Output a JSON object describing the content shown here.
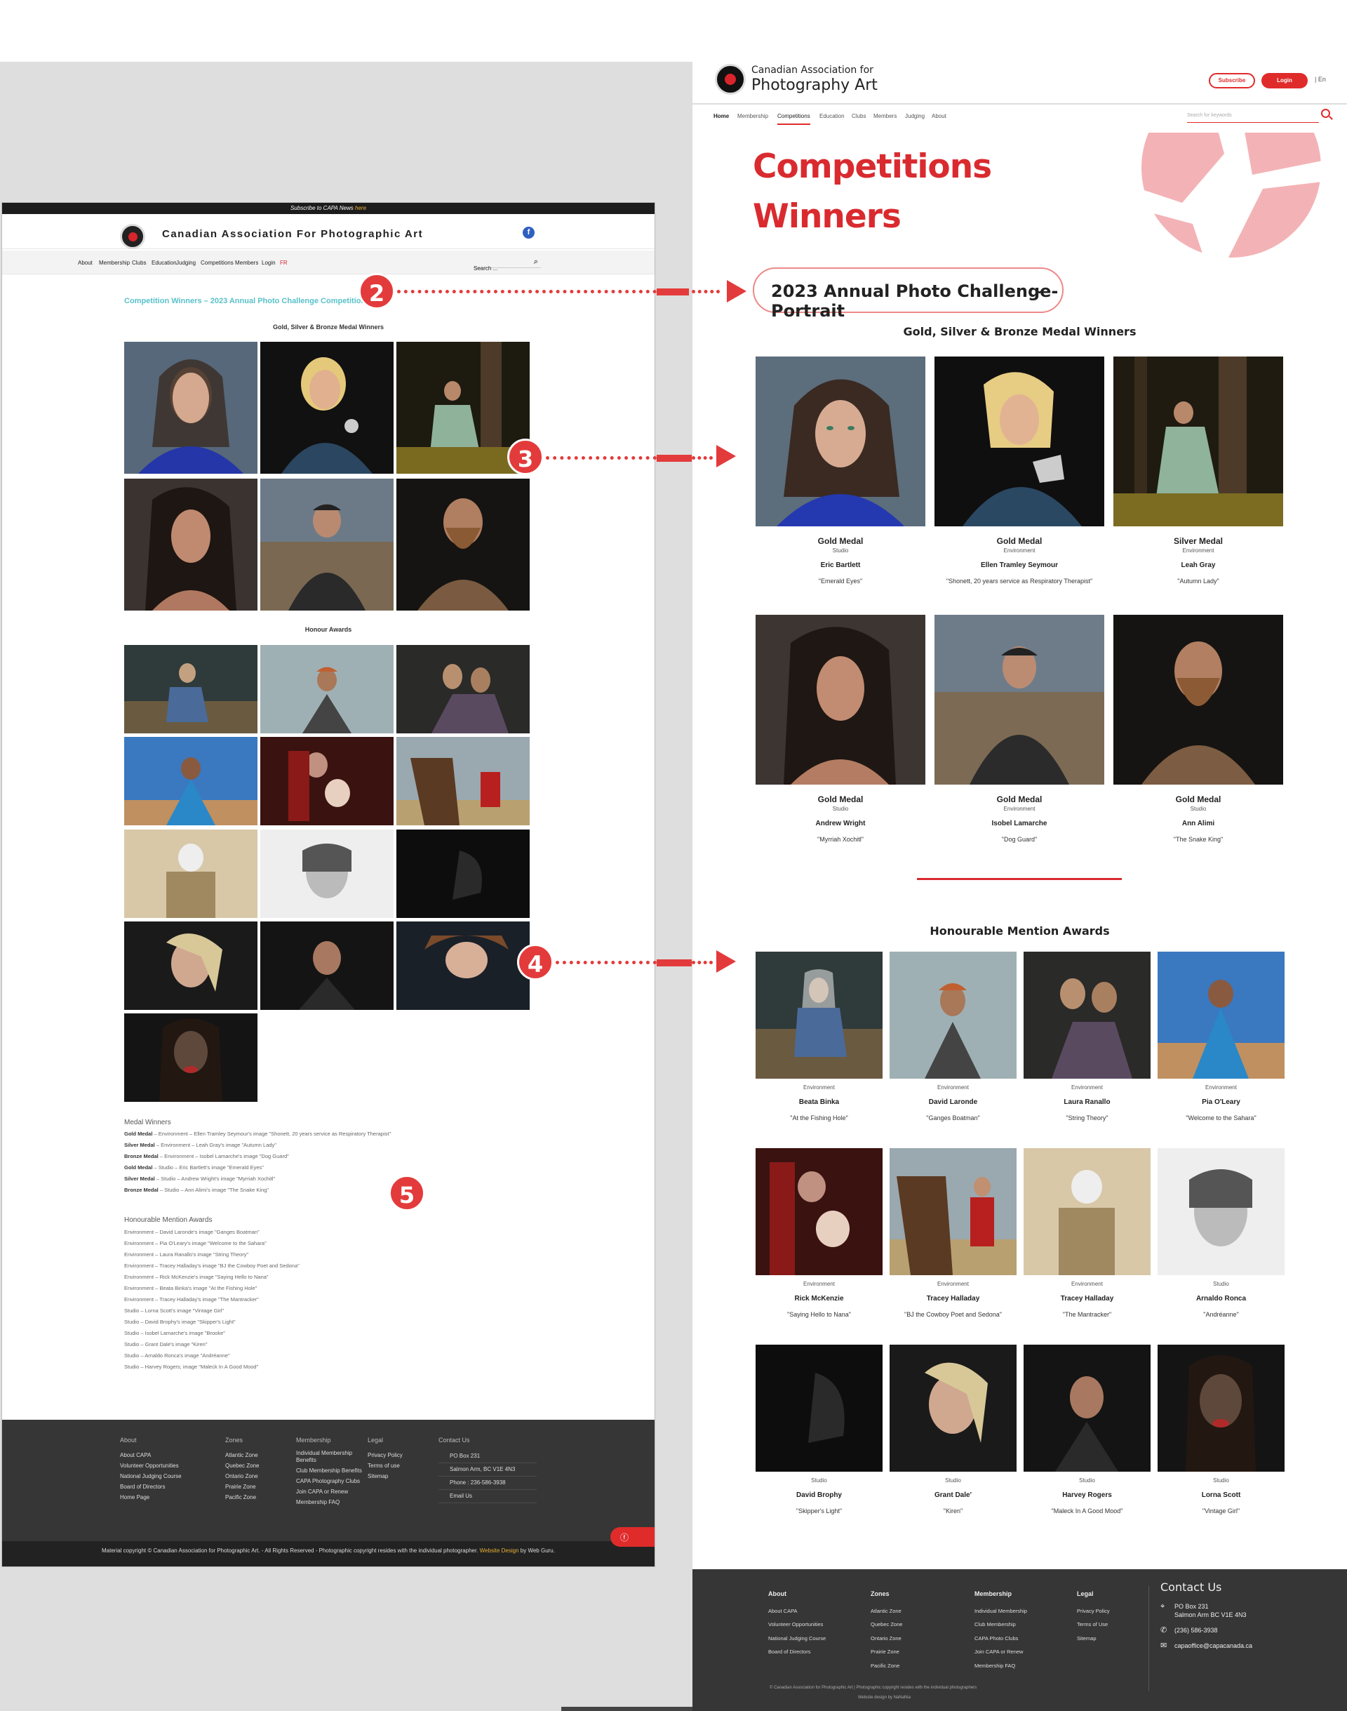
{
  "old_site": {
    "subscribe_text": "Subscribe to CAPA News",
    "subscribe_link": "here",
    "brand": "Canadian Association For Photographic Art",
    "facebook": "f",
    "nav": [
      "About",
      "Membership",
      "Clubs",
      "Education",
      "Judging",
      "Competitions",
      "Members",
      "Login",
      "FR"
    ],
    "search_placeholder": "Search ...",
    "page_title": "Competition Winners – 2023 Annual Photo Challenge Competition",
    "medal_section": "Gold, Silver & Bronze Medal Winners",
    "honour_section": "Honour Awards",
    "medal_list_title": "Medal Winners",
    "medal_list": [
      {
        "medal": "Gold Medal",
        "text": " – Environment – Ellen Tramley Seymour's image \"Shonett, 20 years service as Respiratory Therapist\""
      },
      {
        "medal": "Silver Medal",
        "text": " – Environment – Leah Gray's image \"Autumn Lady\""
      },
      {
        "medal": "Bronze Medal",
        "text": " – Environment – Isobel Lamarche's image \"Dog Guard\""
      },
      {
        "medal": "Gold Medal",
        "text": " – Studio – Eric Bartlett's image \"Emerald Eyes\""
      },
      {
        "medal": "Silver Medal",
        "text": " – Studio – Andrew Wright's image \"Myrriah Xochitl\""
      },
      {
        "medal": "Bronze Medal",
        "text": " – Studio – Ann Alimi's image \"The Snake King\""
      }
    ],
    "honour_list_title": "Honourable Mention Awards",
    "honour_list": [
      "Environment – David Laronde's image \"Ganges Boatman\"",
      "Environment – Pia O'Leary's image \"Welcome to the Sahara\"",
      "Environment – Laura Ranallo's image \"String Theory\"",
      "Environment – Tracey Halladay's image \"BJ the Cowboy Poet and Sedona\"",
      "Environment – Rick McKenzie's image \"Saying Hello to Nana\"",
      "Environment – Beata Binka's image \"At the Fishing Hole\"",
      "Environment – Tracey Halladay's image \"The Mantracker\"",
      "Studio – Lorna Scott's image \"Vintage Girl\"",
      "Studio – David Brophy's image \"Skipper's Light\"",
      "Studio – Isobel Lamarche's image \"Brooke\"",
      "Studio – Grant Dale's image \"Kiren\"",
      "Studio – Arnaldo Ronca's image \"Andréanne\"",
      "Studio – Harvey Rogers; image \"Maleck In A Good Mood\""
    ],
    "footer": {
      "about": {
        "title": "About",
        "items": [
          "About CAPA",
          "Volunteer Opportunities",
          "National Judging Course",
          "Board of Directors",
          "Home Page"
        ]
      },
      "zones": {
        "title": "Zones",
        "items": [
          "Atlantic Zone",
          "Quebec Zone",
          "Ontario Zone",
          "Prairie Zone",
          "Pacific Zone"
        ]
      },
      "membership": {
        "title": "Membership",
        "items": [
          "Individual Membership Benefits",
          "Club Membership Benefits",
          "CAPA Photography Clubs",
          "Join CAPA or Renew",
          "Membership FAQ"
        ]
      },
      "legal": {
        "title": "Legal",
        "items": [
          "Privacy Policy",
          "Terms of use",
          "Sitemap"
        ]
      },
      "contact": {
        "title": "Contact Us",
        "items": [
          "PO Box 231",
          "Salmon Arm, BC V1E 4N3",
          "Phone : 236-586-3938",
          "Email Us"
        ]
      }
    },
    "copyright": "Material copyright © Canadian Association for Photographic Art. - All Rights Reserved - Photographic copyright resides with the individual photographer.",
    "copyright_link": "Website Design",
    "copyright_by": "by Web Guru."
  },
  "new_site": {
    "brand_line1": "Canadian Association for",
    "brand_line2": "Photography Art",
    "subscribe": "Subscribe",
    "login": "Login",
    "lang": "| En",
    "nav": [
      "Home",
      "Membership",
      "Competitions",
      "Education",
      "Clubs",
      "Members",
      "Judging",
      "About"
    ],
    "search_placeholder": "Search for keywords",
    "title1": "Competitions",
    "title2": "Winners",
    "dropdown": "2023 Annual Photo Challenge-Portrait",
    "medal_section": "Gold, Silver & Bronze Medal Winners",
    "medal_winners": [
      {
        "medal": "Gold Medal",
        "category": "Studio",
        "name": "Eric Bartlett",
        "title": "\"Emerald Eyes\""
      },
      {
        "medal": "Gold Medal",
        "category": "Environment",
        "name": "Ellen Tramley Seymour",
        "title": "\"Shonett, 20 years service as Respiratory Therapist\""
      },
      {
        "medal": "Silver Medal",
        "category": "Environment",
        "name": "Leah Gray",
        "title": "\"Autumn Lady\""
      },
      {
        "medal": "Gold Medal",
        "category": "Studio",
        "name": "Andrew Wright",
        "title": "\"Myrriah Xochitl\""
      },
      {
        "medal": "Gold Medal",
        "category": "Environment",
        "name": "Isobel Lamarche",
        "title": "\"Dog Guard\""
      },
      {
        "medal": "Gold Medal",
        "category": "Studio",
        "name": "Ann Alimi",
        "title": "\"The Snake King\""
      }
    ],
    "honour_section": "Honourable Mention Awards",
    "honour_winners": [
      {
        "category": "Environment",
        "name": "Beata Binka",
        "title": "\"At the Fishing Hole\""
      },
      {
        "category": "Environment",
        "name": "David Laronde",
        "title": "\"Ganges Boatman\""
      },
      {
        "category": "Environment",
        "name": "Laura Ranallo",
        "title": "\"String Theory\""
      },
      {
        "category": "Environment",
        "name": "Pia O'Leary",
        "title": "\"Welcome to the Sahara\""
      },
      {
        "category": "Environment",
        "name": "Rick McKenzie",
        "title": "\"Saying Hello to Nana\""
      },
      {
        "category": "Environment",
        "name": "Tracey Halladay",
        "title": "\"BJ the Cowboy Poet and Sedona\""
      },
      {
        "category": "Environment",
        "name": "Tracey Halladay",
        "title": "\"The Mantracker\""
      },
      {
        "category": "Studio",
        "name": "Arnaldo Ronca",
        "title": "\"Andréanne\""
      },
      {
        "category": "Studio",
        "name": "David Brophy",
        "title": "\"Skipper's Light\""
      },
      {
        "category": "Studio",
        "name": "Grant Dale'",
        "title": "\"Kiren\""
      },
      {
        "category": "Studio",
        "name": "Harvey Rogers",
        "title": "\"Maleck In A Good Mood\""
      },
      {
        "category": "Studio",
        "name": "Lorna Scott",
        "title": "\"Vintage Girl\""
      }
    ],
    "footer": {
      "about": {
        "title": "About",
        "items": [
          "About CAPA",
          "Volunteer Opportunities",
          "National Judging Course",
          "Board of Directors"
        ]
      },
      "zones": {
        "title": "Zones",
        "items": [
          "Atlantic Zone",
          "Quebec Zone",
          "Ontario Zone",
          "Prairie Zone",
          "Pacific Zone"
        ]
      },
      "membership": {
        "title": "Membership",
        "items": [
          "Individual Membership",
          "Club Membership",
          "CAPA Photo Clubs",
          "Join CAPA or Renew",
          "Membership FAQ"
        ]
      },
      "legal": {
        "title": "Legal",
        "items": [
          "Privacy Policy",
          "Terms of Use",
          "Sitemap"
        ]
      },
      "contact_title": "Contact Us",
      "address1": "PO Box 231",
      "address2": "Salmon Arm BC V1E 4N3",
      "phone": "(236) 586-3938",
      "email": "capaoffice@capacanada.ca",
      "copyright": "© Canadian Association for Photographic Art | Photographic copyright resides with the individual photographers",
      "design": "Website design by NaNaNia"
    }
  },
  "markers": [
    "2",
    "3",
    "4",
    "5"
  ],
  "colors": {
    "brand_red": "#d92b2f",
    "marker_red": "#e33b3b",
    "footer_dark": "#363636",
    "old_title_teal": "#59c1c9"
  }
}
